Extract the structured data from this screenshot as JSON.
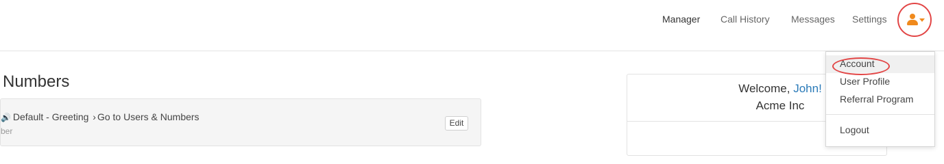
{
  "nav": {
    "manager": "Manager",
    "call_history": "Call History",
    "messages": "Messages",
    "settings": "Settings",
    "user_icon": "user-icon",
    "caret_icon": "caret-down-icon",
    "accent": "#f08a1d",
    "highlight": "#e24545"
  },
  "main": {
    "heading": "Numbers",
    "row": {
      "speaker_icon": "🔊",
      "greeting": "Default - Greeting",
      "arrow": "›",
      "target": "Go to Users & Numbers",
      "subtext": "ber",
      "edit": "Edit"
    }
  },
  "welcome": {
    "prefix": "Welcome, ",
    "name": "John!",
    "company": "Acme Inc",
    "name_color": "#2a7ab8"
  },
  "dropdown": {
    "items": [
      "Account",
      "User Profile",
      "Referral Program"
    ],
    "logout": "Logout"
  }
}
